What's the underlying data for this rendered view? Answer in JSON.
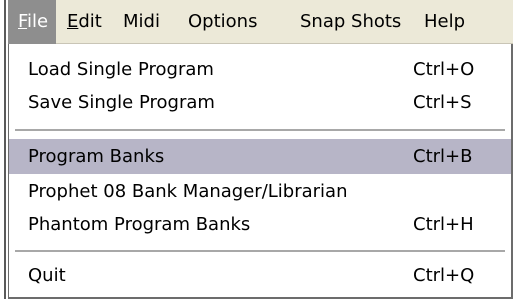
{
  "menubar": {
    "items": [
      {
        "mnemonic": "F",
        "rest": "ile",
        "active": true
      },
      {
        "mnemonic": "E",
        "rest": "dit",
        "active": false
      },
      {
        "mnemonic": "",
        "rest": "Midi",
        "active": false
      },
      {
        "mnemonic": "",
        "rest": "Options",
        "active": false
      },
      {
        "mnemonic": "",
        "rest": "Snap Shots",
        "active": false
      },
      {
        "mnemonic": "",
        "rest": "Help",
        "active": false
      }
    ]
  },
  "file_menu": {
    "items": [
      {
        "label": "Load Single Program",
        "shortcut": "Ctrl+O"
      },
      {
        "label": "Save Single Program",
        "shortcut": "Ctrl+S"
      },
      {
        "label": "Program Banks",
        "shortcut": "Ctrl+B",
        "highlighted": true
      },
      {
        "label": "Prophet 08 Bank Manager/Librarian",
        "shortcut": ""
      },
      {
        "label": "Phantom Program Banks",
        "shortcut": "Ctrl+H"
      },
      {
        "label": "Quit",
        "shortcut": "Ctrl+Q"
      }
    ]
  },
  "colors": {
    "menubar_bg": "#ece9d8",
    "active_menu_bg": "#8e8e8e",
    "highlight_bg": "#b7b5c7",
    "separator": "#a8a8a8"
  }
}
